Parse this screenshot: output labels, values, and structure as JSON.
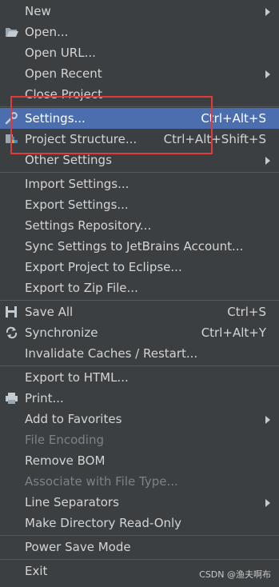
{
  "menu": {
    "items": [
      {
        "label": "New",
        "submenu": true
      },
      {
        "label": "Open...",
        "icon": "folder-open-icon"
      },
      {
        "label": "Open URL..."
      },
      {
        "label": "Open Recent",
        "submenu": true
      },
      {
        "label": "Close Project"
      },
      {
        "label": "Settings...",
        "shortcut": "Ctrl+Alt+S",
        "icon": "wrench-icon",
        "selected": true
      },
      {
        "label": "Project Structure...",
        "shortcut": "Ctrl+Alt+Shift+S",
        "icon": "project-structure-icon"
      },
      {
        "label": "Other Settings",
        "submenu": true
      },
      {
        "label": "Import Settings..."
      },
      {
        "label": "Export Settings..."
      },
      {
        "label": "Settings Repository..."
      },
      {
        "label": "Sync Settings to JetBrains Account..."
      },
      {
        "label": "Export Project to Eclipse..."
      },
      {
        "label": "Export to Zip File..."
      },
      {
        "label": "Save All",
        "shortcut": "Ctrl+S",
        "icon": "save-icon"
      },
      {
        "label": "Synchronize",
        "shortcut": "Ctrl+Alt+Y",
        "icon": "sync-icon"
      },
      {
        "label": "Invalidate Caches / Restart..."
      },
      {
        "label": "Export to HTML..."
      },
      {
        "label": "Print...",
        "icon": "print-icon"
      },
      {
        "label": "Add to Favorites",
        "submenu": true
      },
      {
        "label": "File Encoding",
        "disabled": true
      },
      {
        "label": "Remove BOM"
      },
      {
        "label": "Associate with File Type...",
        "disabled": true
      },
      {
        "label": "Line Separators",
        "submenu": true
      },
      {
        "label": "Make Directory Read-Only"
      },
      {
        "label": "Power Save Mode"
      },
      {
        "label": "Exit"
      }
    ]
  },
  "watermark": "CSDN @渔夫啊布",
  "colors": {
    "background": "#3c3f41",
    "selected": "#4b6eaf",
    "highlight_box": "#e03a3a",
    "disabled_text": "#7f8284"
  }
}
